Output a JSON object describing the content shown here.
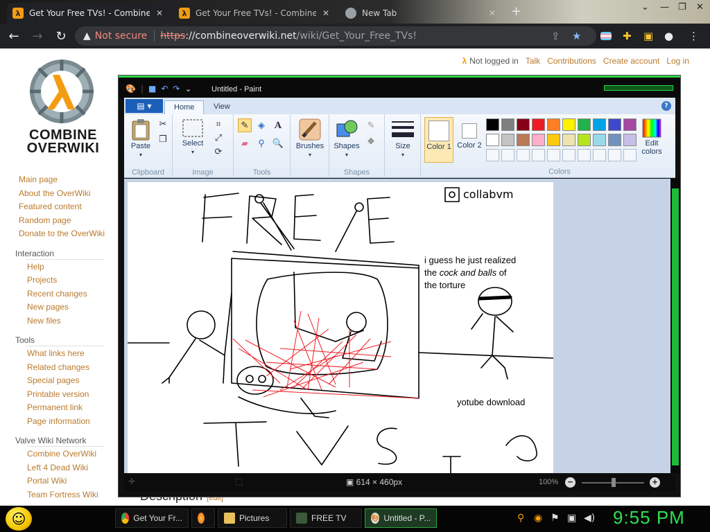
{
  "browser": {
    "tabs": [
      {
        "title": "Get Your Free TVs! - Combine Ov",
        "active": true
      },
      {
        "title": "Get Your Free TVs! - Combine O",
        "active": false
      },
      {
        "title": "New Tab",
        "active": false
      }
    ],
    "address": {
      "warning": "Not secure",
      "protocol": "https",
      "host": "://combineoverwiki.net",
      "path": "/wiki/Get_Your_Free_TVs!"
    }
  },
  "wiki": {
    "logo_text": "COMBINE OVERWIKI",
    "user_links": {
      "not_logged_in": "Not logged in",
      "talk": "Talk",
      "contributions": "Contributions",
      "create_account": "Create account",
      "log_in": "Log in"
    },
    "nav": {
      "main": [
        "Main page",
        "About the OverWiki",
        "Featured content",
        "Random page",
        "Donate to the OverWiki"
      ],
      "interaction_heading": "Interaction",
      "interaction": [
        "Help",
        "Projects",
        "Recent changes",
        "New pages",
        "New files"
      ],
      "tools_heading": "Tools",
      "tools": [
        "What links here",
        "Related changes",
        "Special pages",
        "Printable version",
        "Permanent link",
        "Page information"
      ],
      "network_heading": "Valve Wiki Network",
      "network": [
        "Combine OverWiki",
        "Left 4 Dead Wiki",
        "Portal Wiki",
        "Team Fortress Wiki"
      ]
    },
    "section_heading": "Description",
    "section_edit": "edit"
  },
  "paint": {
    "title": "Untitled - Paint",
    "tabs": {
      "home": "Home",
      "view": "View"
    },
    "groups": {
      "clipboard": "Clipboard",
      "image": "Image",
      "tools": "Tools",
      "shapes": "Shapes",
      "colors": "Colors"
    },
    "buttons": {
      "paste": "Paste",
      "select": "Select",
      "brushes": "Brushes",
      "shapes": "Shapes",
      "size": "Size",
      "color1": "Color 1",
      "color2": "Color 2",
      "edit_colors": "Edit colors"
    },
    "palette": [
      "#000000",
      "#7f7f7f",
      "#880015",
      "#ed1c24",
      "#ff7f27",
      "#fff200",
      "#22b14c",
      "#00a2e8",
      "#3f48cc",
      "#a349a4",
      "#ffffff",
      "#c3c3c3",
      "#b97a57",
      "#ffaec9",
      "#ffc90e",
      "#efe4b0",
      "#b5e61d",
      "#99d9ea",
      "#7092be",
      "#c8bfe7"
    ],
    "canvas_text": {
      "free": "FREE",
      "tvs": "TVS",
      "collabvm": "collabvm",
      "caption_1": "i guess he just realized",
      "caption_2_pre": "the ",
      "caption_2_em": "cock and balls",
      "caption_2_post": " of",
      "caption_3": "the torture",
      "youtube": "yotube download"
    },
    "status": {
      "dimensions": "614 × 460px",
      "zoom": "100%"
    }
  },
  "taskbar": {
    "items": [
      {
        "label": "Get Your Fr...",
        "icon": "chrome-icon"
      },
      {
        "label": "",
        "icon": "firefox-icon"
      },
      {
        "label": "Pictures",
        "icon": "folder-icon"
      },
      {
        "label": "FREE TV",
        "icon": "image-icon"
      },
      {
        "label": "Untitled - P...",
        "icon": "paint-icon"
      }
    ],
    "clock": "9:55 PM"
  },
  "colors": {
    "accent_link": "#ba7a2c",
    "paint_green": "#2fd44a"
  }
}
